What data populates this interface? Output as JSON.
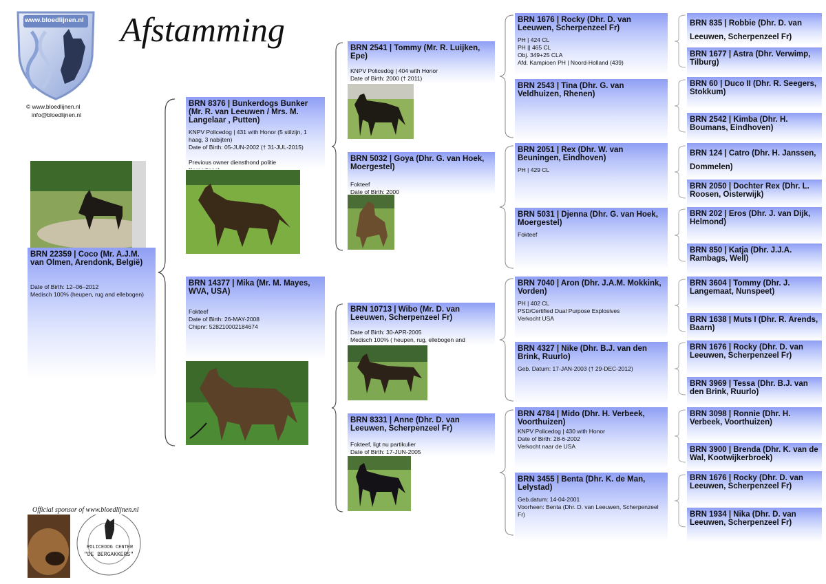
{
  "page": {
    "title": "Afstamming",
    "website": "© www.bloedlijnen.nl",
    "email": "info@bloedlijnen.nl",
    "logo_text": "www.bloedlijnen.nl",
    "sponsor_text": "Official sponsor of www.bloedlijnen.nl",
    "sponsor_name": "POLICEDOG CENTER",
    "sponsor_sub": "\"DE BERGAKKERS\""
  },
  "dog": {
    "name": "BRN 22359 | Coco (Mr. A.J.M. van Olmen, Arendonk, België)",
    "info": "Date of Birth: 12–06–2012\nMedisch 100% (heupen, rug and ellebogen)"
  },
  "parents": [
    {
      "name": "BRN 8376 | Bunkerdogs Bunker (Mr. R. van Leeuwen / Mrs. M. Langelaar , Putten)",
      "info": "KNPV Policedog | 431 with Honor (5 stilzijn, 1 haag, 3 nabijten)\nDate of Birth: 05-JUN-2002 († 31-JUL-2015)\n\nPrevious owner diensthond politie\nKorpsdienst"
    },
    {
      "name": "BRN 14377 | Mika (Mr.  M. Mayes, WVA, USA)",
      "info": "Fokteef\nDate of Birth: 26-MAY-2008\nChipnr: 528210002184674"
    }
  ],
  "grandparents": [
    {
      "name": "BRN 2541 | Tommy (Mr. R. Luijken, Epe)",
      "info": "KNPV Policedog | 404 with Honor\nDate of Birth: 2000 († 2011)"
    },
    {
      "name": "BRN 5032 | Goya (Dhr. G. van Hoek, Moergestel)",
      "info": "Fokteef\nDate of Birth: 2000"
    },
    {
      "name": "BRN 10713 | Wibo (Mr. D. van Leeuwen, Scherpenzeel Fr)",
      "info": "Date of Birth: 30-APR-2005\nMedisch 100% ( heupen, rug, ellebogen and"
    },
    {
      "name": "BRN 8331 | Anne (Dhr. D. van Leeuwen, Scherpenzeel Fr)",
      "info": "Fokteef, ligt nu partikulier\nDate of Birth: 17-JUN-2005"
    }
  ],
  "great_grandparents": [
    {
      "name": "BRN 1676 | Rocky (Dhr. D. van Leeuwen, Scherpenzeel Fr)",
      "info": "PH | 424 CL\nPH || 465 CL\nObj. 349+25 CLA\nAfd. Kampioen PH | Noord-Holland (439)"
    },
    {
      "name": "BRN 2543 | Tina (Dhr. G. van Veldhuizen, Rhenen)",
      "info": ""
    },
    {
      "name": "BRN 2051 | Rex (Dhr. W. van Beuningen, Eindhoven)",
      "info": "PH | 429 CL"
    },
    {
      "name": "BRN 5031 | Djenna (Dhr. G. van Hoek, Moergestel)",
      "info": "Fokteef"
    },
    {
      "name": "BRN 7040 | Aron (Dhr. J.A.M. Mokkink, Vorden)",
      "info": "PH | 402 CL\nPSD/Certified Dual Purpose Explosives\nVerkocht USA"
    },
    {
      "name": "BRN 4327 | Nike (Dhr. B.J. van den Brink, Ruurlo)",
      "info": "Geb. Datum: 17-JAN-2003 († 29-DEC-2012)"
    },
    {
      "name": "BRN 4784 | Mido (Dhr. H. Verbeek, Voorthuizen)",
      "info": "KNPV Policedog | 430 with Honor\nDate of Birth: 28-6-2002\nVerkocht naar de USA"
    },
    {
      "name": "BRN 3455 | Benta (Dhr. K. de Man, Lelystad)",
      "info": "Geb.datum: 14-04-2001\nVoorheen: Benta (Dhr. D. van Leeuwen, Scherpenzeel Fr)"
    }
  ],
  "gen4": [
    {
      "name": "BRN 835 | Robbie (Dhr. D. van Leeuwen, Scherpenzeel Fr)"
    },
    {
      "name": "BRN 1677 | Astra (Dhr. Verwimp, Tilburg)"
    },
    {
      "name": "BRN 60 | Duco II (Dhr. R. Seegers, Stokkum)"
    },
    {
      "name": "BRN 2542 | Kimba (Dhr. H. Boumans, Eindhoven)"
    },
    {
      "name": "BRN 124 | Catro (Dhr. H. Janssen, Dommelen)"
    },
    {
      "name": "BRN 2050 | Dochter Rex (Dhr. L. Roosen, Oisterwijk)"
    },
    {
      "name": "BRN 202 | Eros (Dhr. J. van Dijk, Helmond)"
    },
    {
      "name": "BRN 850 | Katja (Dhr. J.J.A. Rambags, Well)"
    },
    {
      "name": "BRN 3604 | Tommy (Dhr. J. Langemaat, Nunspeet)"
    },
    {
      "name": "BRN 1638 | Muts I (Dhr. R. Arends, Baarn)"
    },
    {
      "name": "BRN 1676 | Rocky (Dhr. D. van Leeuwen, Scherpenzeel Fr)"
    },
    {
      "name": "BRN 3969 | Tessa (Dhr. B.J. van den Brink, Ruurlo)"
    },
    {
      "name": "BRN 3098 | Ronnie (Dhr. H. Verbeek, Voorthuizen)"
    },
    {
      "name": "BRN 3900 | Brenda (Dhr. K. van de Wal, Kootwijkerbroek)"
    },
    {
      "name": "BRN 1676 | Rocky (Dhr. D. van Leeuwen, Scherpenzeel Fr)"
    },
    {
      "name": "BRN 1934 | Nika (Dhr. D. van Leeuwen, Scherpenzeel Fr)"
    }
  ],
  "colors": {
    "card_top": "#8f9ef4",
    "brace": "#444444"
  }
}
